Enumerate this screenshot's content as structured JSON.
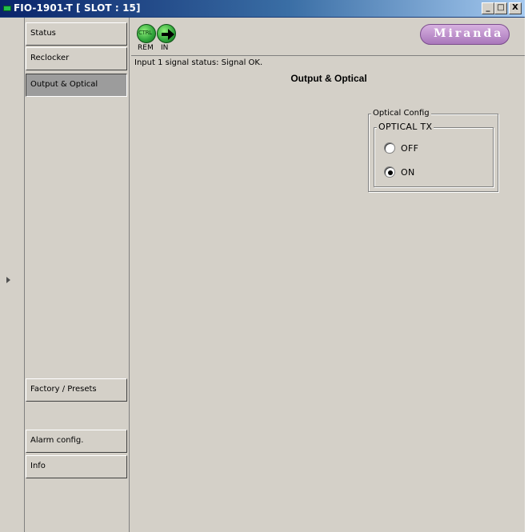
{
  "window": {
    "title": "FIO-1901-T [ SLOT : 15]",
    "controls": {
      "minimize": "_",
      "maximize": "□",
      "close": "X"
    }
  },
  "sidebar": {
    "items": [
      {
        "label": "Status",
        "active": false
      },
      {
        "label": "Reclocker",
        "active": false
      },
      {
        "label": "Output & Optical",
        "active": true
      },
      {
        "label": "Factory / Presets",
        "active": false
      },
      {
        "label": "Alarm config.",
        "active": false
      },
      {
        "label": "Info",
        "active": false
      }
    ]
  },
  "header": {
    "icons": [
      {
        "name": "ctrl-icon",
        "text": "CTRL",
        "label": "REM"
      },
      {
        "name": "input-arrow-icon",
        "label": "IN"
      }
    ],
    "logo": "Miranda",
    "status": "Input 1 signal status: Signal OK."
  },
  "main": {
    "title": "Output & Optical",
    "optical_config": {
      "legend": "Optical Config",
      "tx_group": {
        "legend": "OPTICAL TX",
        "options": [
          {
            "label": "OFF",
            "selected": false
          },
          {
            "label": "ON",
            "selected": true
          }
        ]
      }
    }
  },
  "colors": {
    "titlebar_start": "#0a246a",
    "titlebar_end": "#a6caf0",
    "panel_bg": "#d4d0c8",
    "active_tab": "#9c9c9c",
    "status_led": "#22c04a",
    "logo": "#a977bb"
  }
}
